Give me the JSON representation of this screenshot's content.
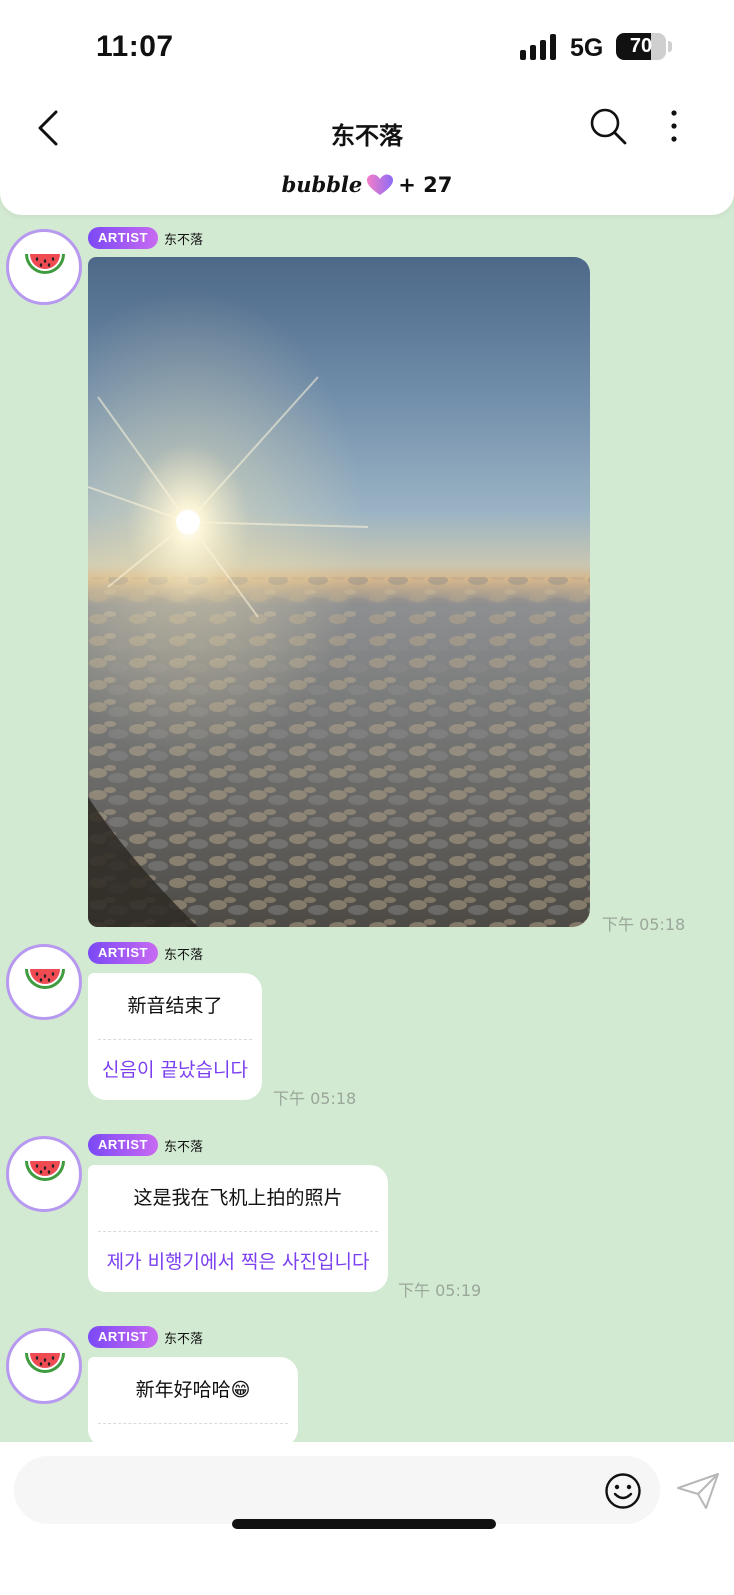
{
  "status_bar": {
    "time": "11:07",
    "network": "5G",
    "battery_level": "70",
    "battery_fraction": 0.7
  },
  "header": {
    "title": "东不落",
    "subscribe_logo": "bubble",
    "subscribe_count": "+ 27",
    "accent_color": "#7b3ff0"
  },
  "messages": [
    {
      "badge": "ARTIST",
      "sender": "东不落",
      "type": "photo",
      "time": "下午 05:18"
    },
    {
      "badge": "ARTIST",
      "sender": "东不落",
      "type": "text",
      "original": "新音结束了",
      "translation": "신음이 끝났습니다",
      "time": "下午 05:18"
    },
    {
      "badge": "ARTIST",
      "sender": "东不落",
      "type": "text",
      "original": "这是我在飞机上拍的照片",
      "translation": "제가 비행기에서 찍은 사진입니다",
      "time": "下午 05:19"
    },
    {
      "badge": "ARTIST",
      "sender": "东不落",
      "type": "text",
      "original": "新年好哈哈😁",
      "translation": ""
    }
  ],
  "input": {
    "placeholder": ""
  },
  "icons": {
    "back": "chevron-left-icon",
    "search": "search-icon",
    "more": "more-vertical-icon",
    "emoji": "emoji-icon",
    "send": "send-icon",
    "avatar": "watermelon-icon"
  },
  "colors": {
    "chat_background": "#d3ead2",
    "translation_text": "#7b3ff0",
    "badge_gradient_start": "#7b49f5",
    "badge_gradient_end": "#c86af2"
  }
}
